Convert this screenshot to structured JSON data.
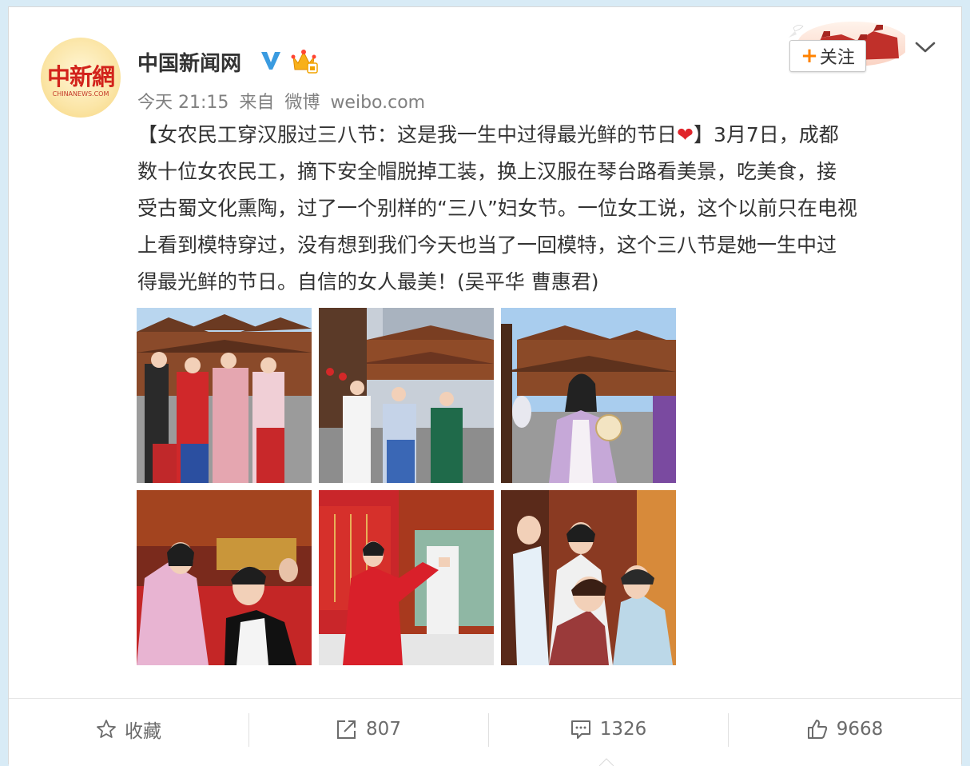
{
  "post": {
    "author": {
      "name": "中国新闻网",
      "avatar_text": "中新網",
      "avatar_subtext": "CHINANEWS.COM"
    },
    "meta": {
      "time": "今天 21:15",
      "source_prefix": "来自",
      "source_app": "微博",
      "source_domain": "weibo.com"
    },
    "follow_label": "关注",
    "follow_plus": "+",
    "content": {
      "line1_a": "【女农民工穿汉服过三八节：这是我一生中过得最光鲜的节日",
      "heart": "❤",
      "line1_b": "】3月7日，成都",
      "line2": "数十位女农民工，摘下安全帽脱掉工装，换上汉服在琴台路看美景，吃美食，接",
      "line3": "受古蜀文化熏陶，过了一个别样的“三八”妇女节。一位女工说，这个以前只在电视",
      "line4": "上看到模特穿过，没有想到我们今天也当了一回模特，这个三八节是她一生中过",
      "line5": "得最光鲜的节日。自信的女人最美！(吴平华 曹惠君)"
    }
  },
  "actions": {
    "favorite_label": "收藏",
    "repost_count": "807",
    "comment_count": "1326",
    "like_count": "9668"
  },
  "colors": {
    "page_bg": "#d8ebf6",
    "accent_orange": "#ff8200",
    "verified_blue": "#3a9be0",
    "text_gray": "#808080"
  }
}
